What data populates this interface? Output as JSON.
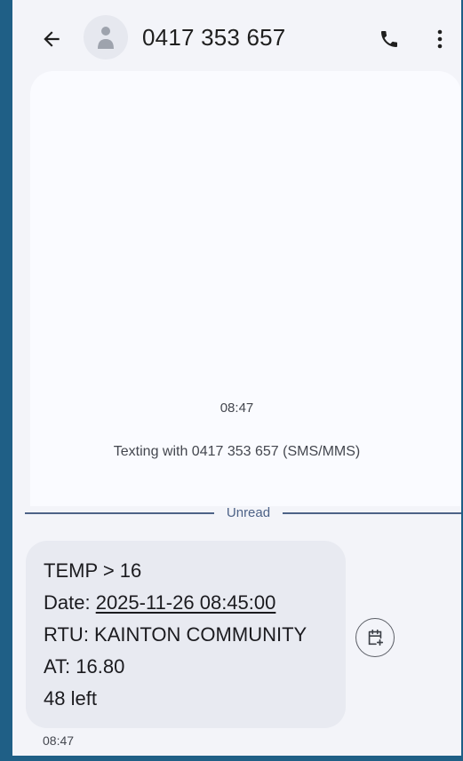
{
  "header": {
    "title": "0417 353 657",
    "back_icon": "arrow-back-icon",
    "avatar_icon": "person-icon",
    "call_icon": "phone-icon",
    "more_icon": "more-vert-icon"
  },
  "conversation": {
    "start_time": "08:47",
    "texting_info": "Texting with 0417 353 657 (SMS/MMS)",
    "unread_label": "Unread"
  },
  "message": {
    "line1": "TEMP > 16",
    "date_prefix": "Date: ",
    "date_value": "2025-11-26 08:45:00",
    "line3": "RTU: KAINTON COMMUNITY",
    "line4": "AT: 16.80",
    "line5": "48 left",
    "time": "08:47",
    "action_icon": "calendar-add-icon"
  },
  "colors": {
    "outer_border": "#1f5f86",
    "background": "#f3f4f9",
    "bubble": "#e8eaf1",
    "divider": "#4d6287"
  }
}
